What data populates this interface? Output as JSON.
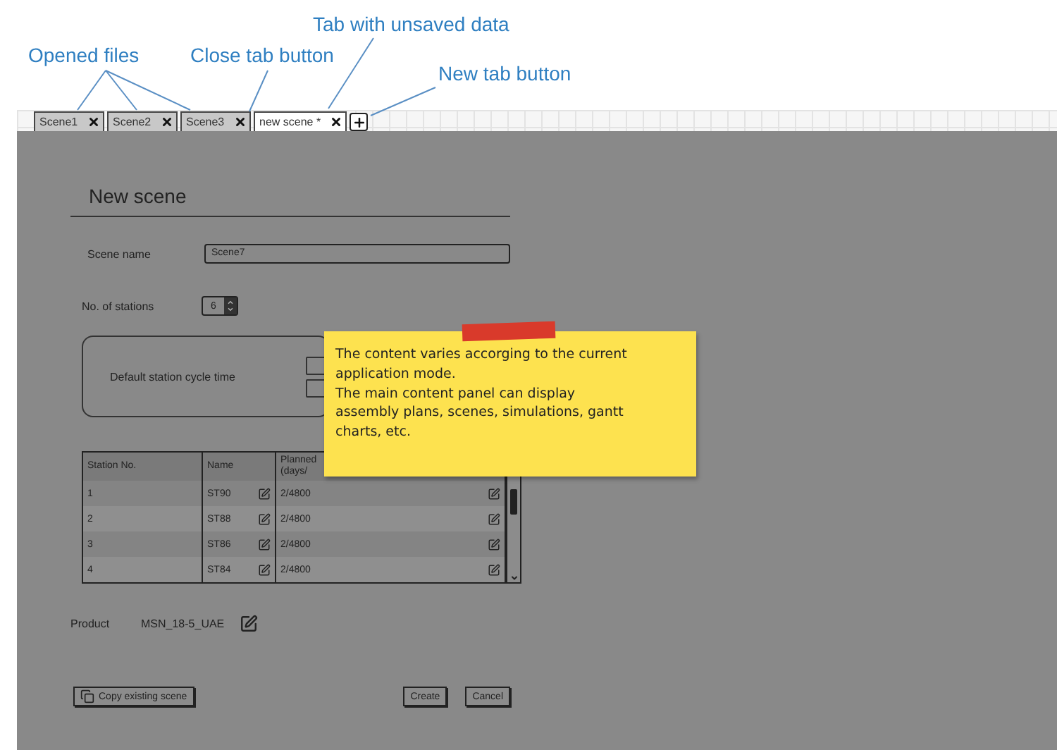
{
  "annotations": [
    {
      "text": "Opened files"
    },
    {
      "text": "Close tab button"
    },
    {
      "text": "Tab with unsaved data"
    },
    {
      "text": "New tab button"
    }
  ],
  "tabs": [
    {
      "label": "Scene1",
      "selected": false
    },
    {
      "label": "Scene2",
      "selected": false
    },
    {
      "label": "Scene3",
      "selected": false
    },
    {
      "label": "new scene *",
      "selected": true
    }
  ],
  "form": {
    "title": "New scene",
    "scene_name": {
      "label": "Scene name",
      "value": "Scene7"
    },
    "stations": {
      "label": "No. of stations",
      "value": "6"
    },
    "cycle_time": {
      "label": "Default station cycle time"
    },
    "table": {
      "columns": [
        [
          "Station No."
        ],
        [
          "Name"
        ],
        [
          "Planned",
          "(days/"
        ]
      ],
      "rows": [
        {
          "no": "1",
          "name": "ST90",
          "planned": "2/4800"
        },
        {
          "no": "2",
          "name": "ST88",
          "planned": "2/4800"
        },
        {
          "no": "3",
          "name": "ST86",
          "planned": "2/4800"
        },
        {
          "no": "4",
          "name": "ST84",
          "planned": "2/4800"
        }
      ]
    },
    "product": {
      "label": "Product",
      "value": "MSN_18-5_UAE"
    },
    "buttons": {
      "copy": "Copy existing scene",
      "create": "Create",
      "cancel": "Cancel"
    }
  },
  "note": {
    "paragraphs": [
      "The content varies accorging to the current application mode.",
      "The main content panel can display assembly plans, scenes, simulations, gantt charts, etc."
    ]
  }
}
